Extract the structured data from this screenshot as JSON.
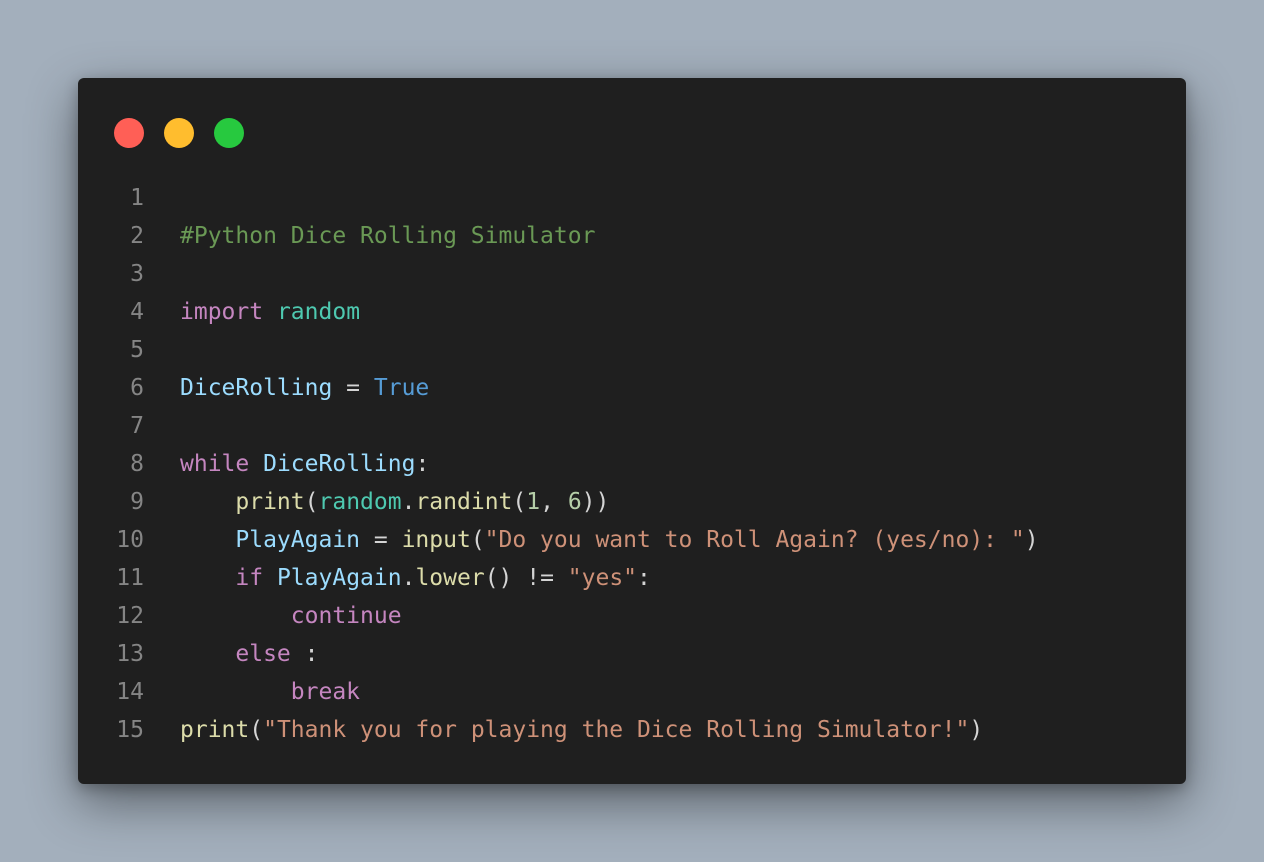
{
  "window": {
    "colors": {
      "background": "#1f1f1f",
      "red": "#ff5f56",
      "yellow": "#ffbd2e",
      "green": "#27c93f"
    }
  },
  "line_numbers": [
    "1",
    "2",
    "3",
    "4",
    "5",
    "6",
    "7",
    "8",
    "9",
    "10",
    "11",
    "12",
    "13",
    "14",
    "15"
  ],
  "code": {
    "l2": {
      "comment": "#Python Dice Rolling Simulator"
    },
    "l4": {
      "kw": "import",
      "sp": " ",
      "mod": "random"
    },
    "l6": {
      "var": "DiceRolling",
      "op": " = ",
      "const": "True"
    },
    "l8": {
      "kw": "while",
      "sp": " ",
      "var": "DiceRolling",
      "colon": ":"
    },
    "l9": {
      "indent": "    ",
      "fn": "print",
      "p1": "(",
      "mod": "random",
      "dot": ".",
      "fn2": "randint",
      "p2": "(",
      "n1": "1",
      "comma": ", ",
      "n2": "6",
      "p3": "))"
    },
    "l10": {
      "indent": "    ",
      "var": "PlayAgain",
      "op": " = ",
      "fn": "input",
      "p1": "(",
      "str": "\"Do you want to Roll Again? (yes/no): \"",
      "p2": ")"
    },
    "l11": {
      "indent": "    ",
      "kw": "if",
      "sp": " ",
      "var": "PlayAgain",
      "dot": ".",
      "fn": "lower",
      "p1": "() != ",
      "str": "\"yes\"",
      "colon": ":"
    },
    "l12": {
      "indent": "        ",
      "kw": "continue"
    },
    "l13": {
      "indent": "    ",
      "kw": "else",
      "colon": " :"
    },
    "l14": {
      "indent": "        ",
      "kw": "break"
    },
    "l15": {
      "fn": "print",
      "p1": "(",
      "str": "\"Thank you for playing the Dice Rolling Simulator!\"",
      "p2": ")"
    }
  }
}
